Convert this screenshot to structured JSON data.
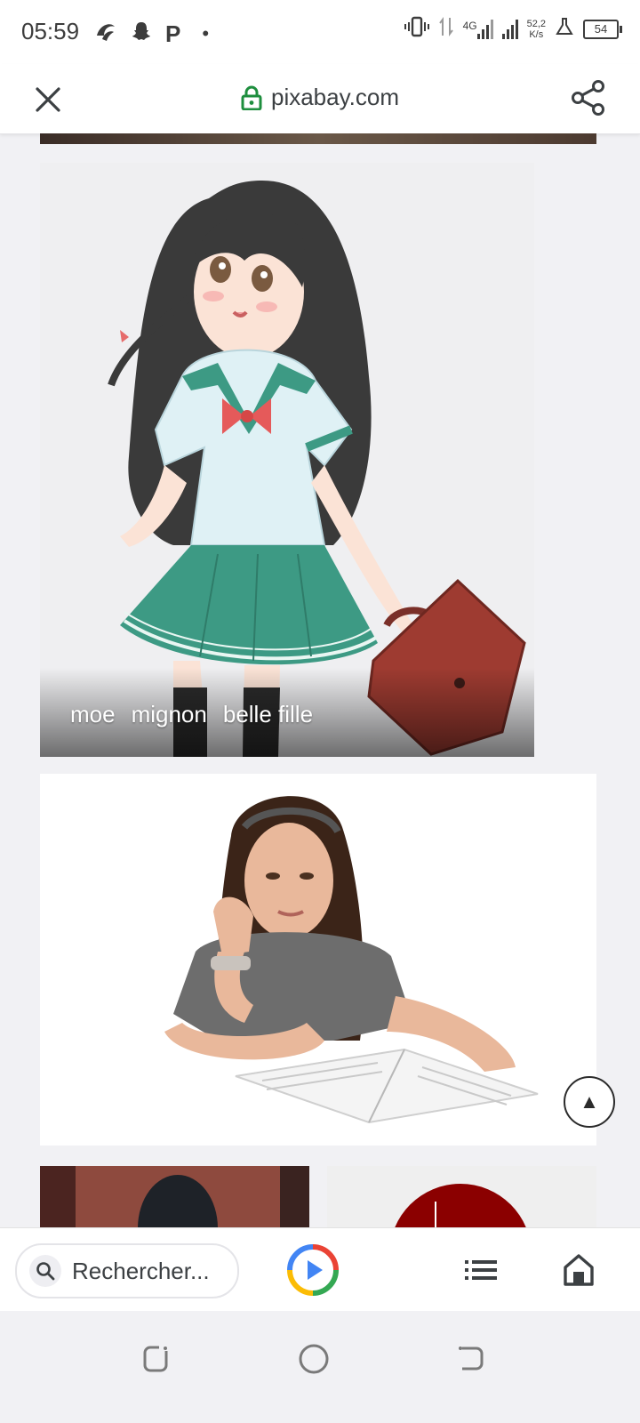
{
  "status_bar": {
    "time": "05:59",
    "left_icons": [
      "swirl-app-icon",
      "snapchat-icon",
      "p-app-icon",
      "dot-icon"
    ],
    "p_glyph": "P",
    "dot_glyph": "•",
    "network": "4G",
    "speed_value": "52,2",
    "speed_unit": "K/s",
    "battery": "54"
  },
  "browser": {
    "url": "pixabay.com",
    "close_icon": "close-icon",
    "share_icon": "share-icon",
    "lock_color": "#1e8e3e"
  },
  "results": {
    "anime_card": {
      "tags": [
        "moe",
        "mignon",
        "belle fille"
      ]
    }
  },
  "toolbar": {
    "search_placeholder": "Rechercher..."
  },
  "scroll_top_glyph": "▲",
  "colors": {
    "accent_blue": "#4285f4",
    "lens_red": "#ea4335",
    "lens_yellow": "#fbbc05",
    "lens_green": "#34a853"
  }
}
